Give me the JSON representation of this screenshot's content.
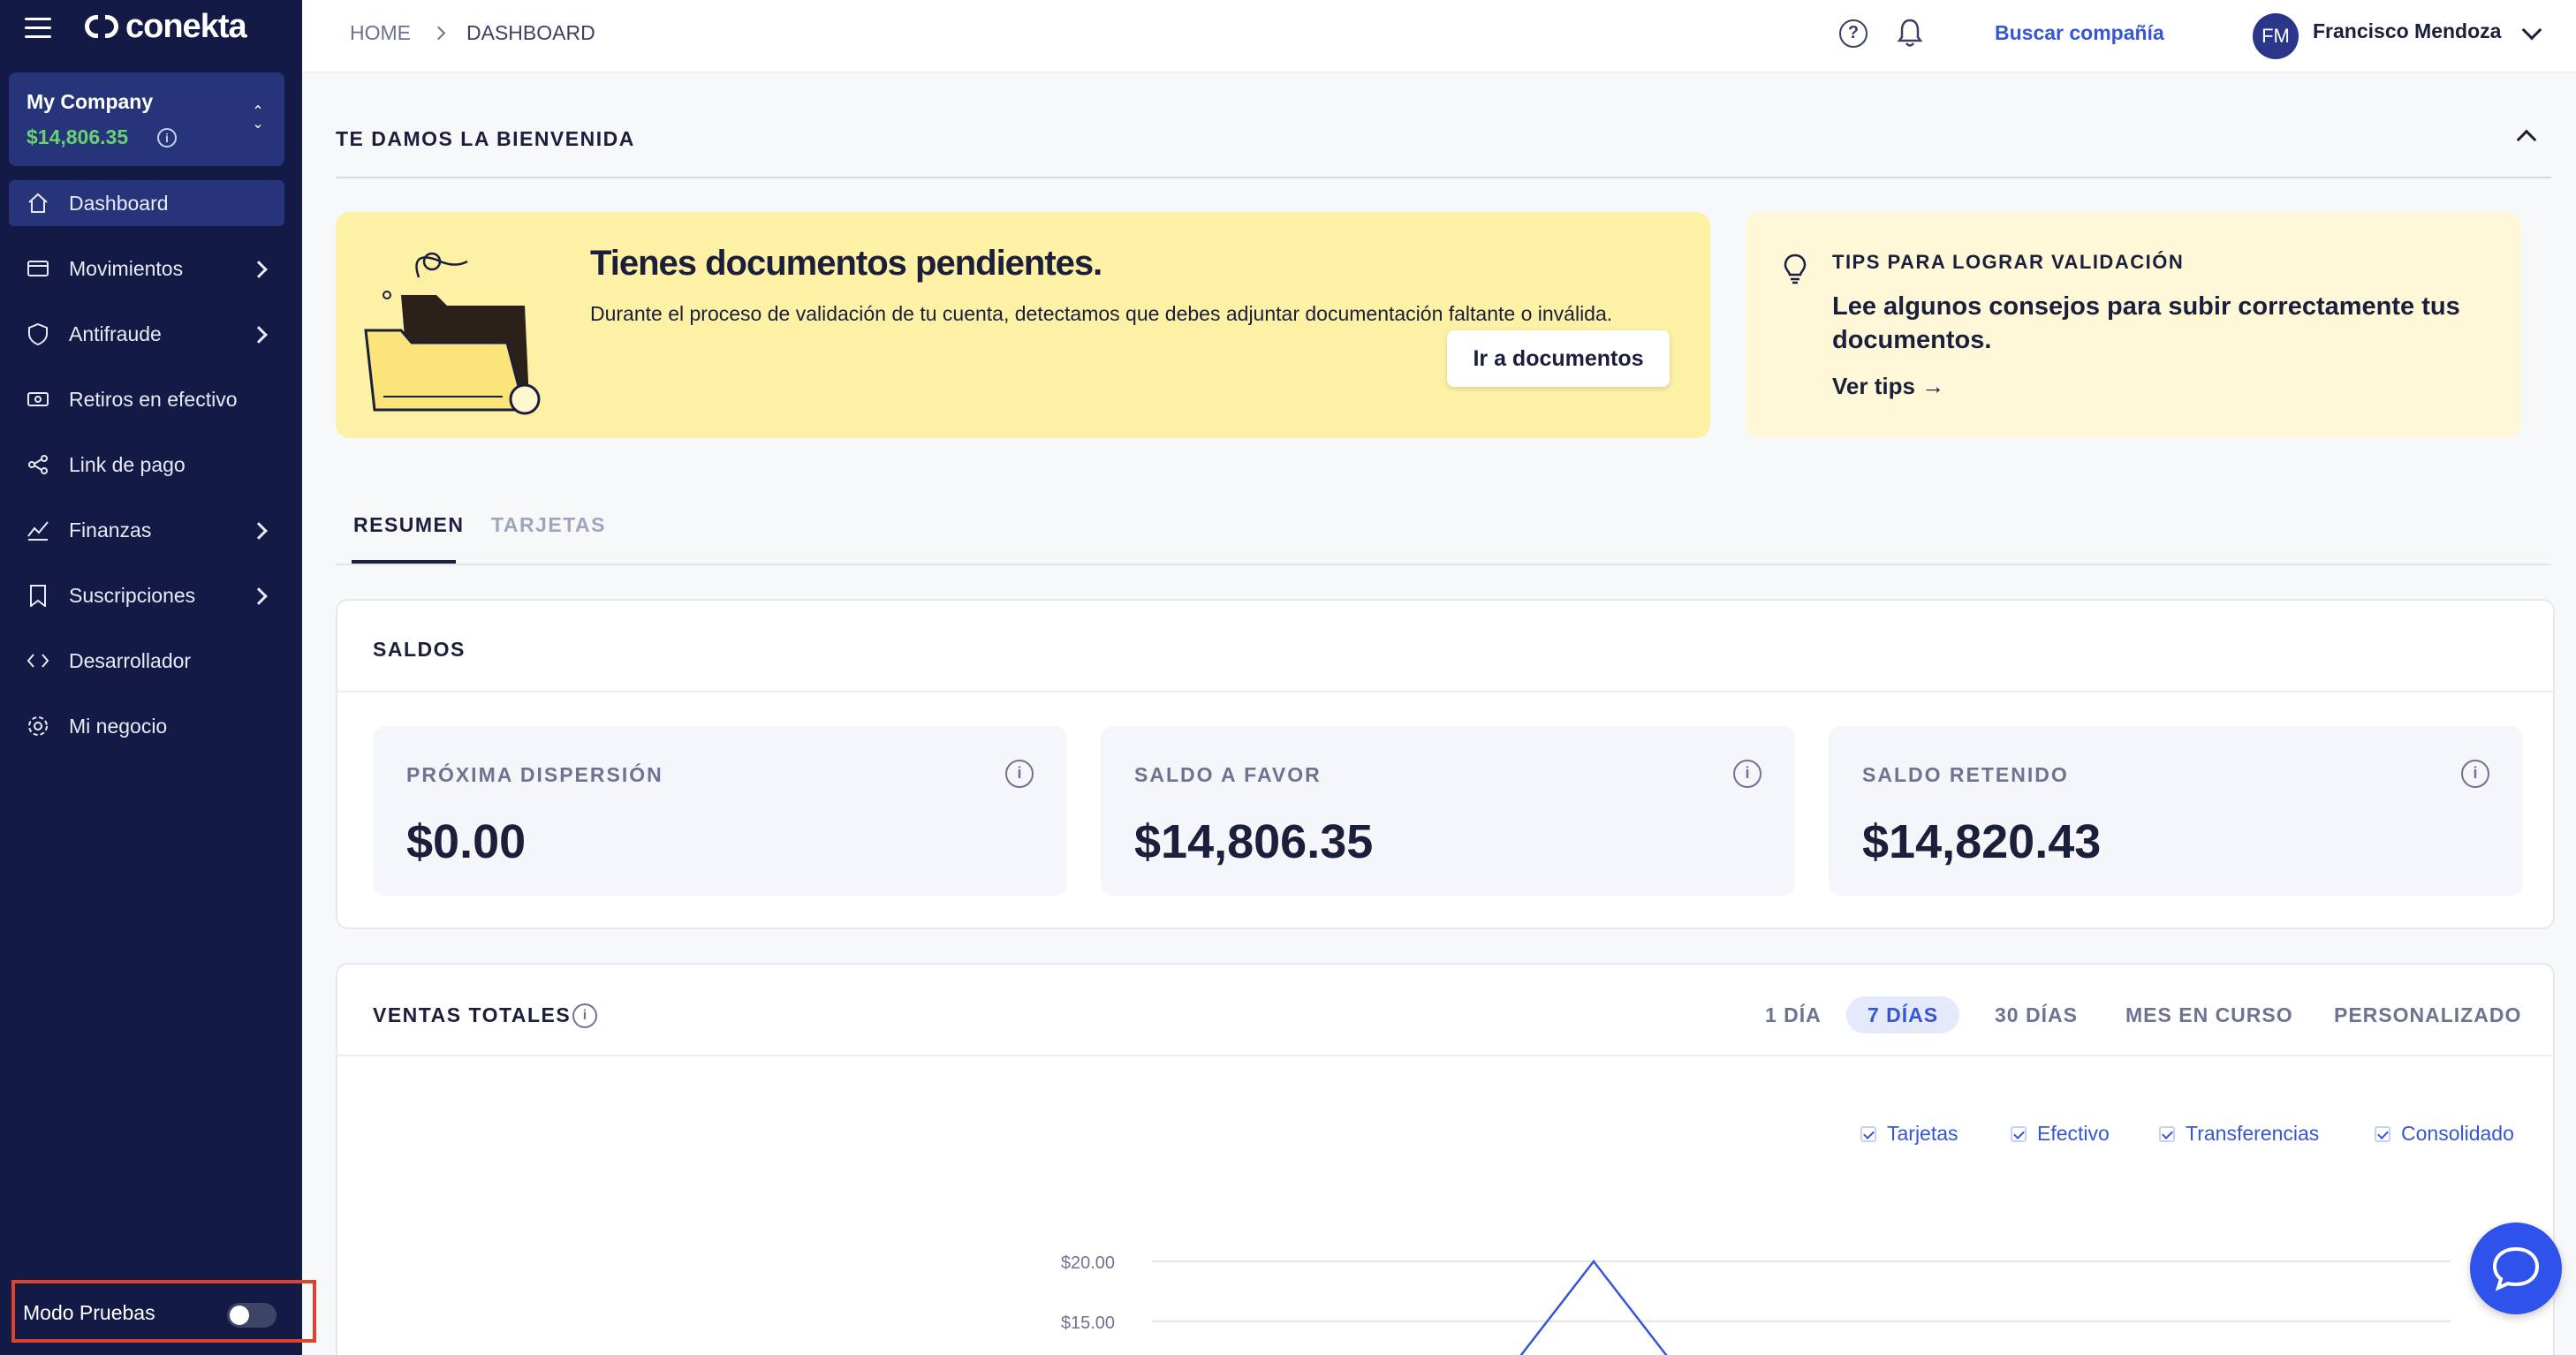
{
  "app": {
    "logo_text": "conekta"
  },
  "company": {
    "name": "My Company",
    "balance": "$14,806.35"
  },
  "nav": {
    "items": [
      {
        "label": "Dashboard",
        "icon": "home-icon",
        "active": true,
        "has_submenu": false
      },
      {
        "label": "Movimientos",
        "icon": "wallet-icon",
        "active": false,
        "has_submenu": true
      },
      {
        "label": "Antifraude",
        "icon": "shield-icon",
        "active": false,
        "has_submenu": true
      },
      {
        "label": "Retiros en efectivo",
        "icon": "cash-icon",
        "active": false,
        "has_submenu": false
      },
      {
        "label": "Link de pago",
        "icon": "share-icon",
        "active": false,
        "has_submenu": false
      },
      {
        "label": "Finanzas",
        "icon": "chart-line-icon",
        "active": false,
        "has_submenu": true
      },
      {
        "label": "Suscripciones",
        "icon": "bookmark-icon",
        "active": false,
        "has_submenu": true
      },
      {
        "label": "Desarrollador",
        "icon": "code-icon",
        "active": false,
        "has_submenu": false
      },
      {
        "label": "Mi negocio",
        "icon": "gear-icon",
        "active": false,
        "has_submenu": false
      }
    ]
  },
  "test_mode": {
    "label": "Modo Pruebas",
    "enabled": false
  },
  "header": {
    "breadcrumb": [
      "HOME",
      "DASHBOARD"
    ],
    "search_company": "Buscar compañía",
    "user_initials": "FM",
    "user_name": "Francisco Mendoza"
  },
  "welcome": {
    "title": "TE DAMOS LA BIENVENIDA",
    "pending": {
      "title": "Tienes documentos pendientes.",
      "description": "Durante el proceso de validación de tu cuenta, detectamos que debes adjuntar documentación faltante o inválida.",
      "button": "Ir a documentos"
    },
    "tips": {
      "label": "TIPS PARA LOGRAR VALIDACIÓN",
      "headline": "Lee algunos consejos para subir correctamente tus documentos.",
      "link": "Ver tips →"
    }
  },
  "tabs": [
    {
      "label": "RESUMEN",
      "active": true
    },
    {
      "label": "TARJETAS",
      "active": false
    }
  ],
  "balances": {
    "title": "SALDOS",
    "cards": [
      {
        "label": "PRÓXIMA DISPERSIÓN",
        "value": "$0.00"
      },
      {
        "label": "SALDO A FAVOR",
        "value": "$14,806.35"
      },
      {
        "label": "SALDO RETENIDO",
        "value": "$14,820.43"
      }
    ]
  },
  "sales": {
    "title": "VENTAS TOTALES",
    "ranges": [
      {
        "label": "1 DÍA",
        "active": false
      },
      {
        "label": "7 DÍAS",
        "active": true
      },
      {
        "label": "30 DÍAS",
        "active": false
      },
      {
        "label": "MES EN CURSO",
        "active": false
      },
      {
        "label": "PERSONALIZADO",
        "active": false
      }
    ],
    "legend": [
      "Tarjetas",
      "Efectivo",
      "Transferencias",
      "Consolidado"
    ]
  },
  "chart_data": {
    "type": "line",
    "y_ticks": [
      "$20.00",
      "$15.00"
    ],
    "series_color": "#3556d6",
    "grid": true
  },
  "colors": {
    "sidebar": "#121a45",
    "accent": "#3556d6",
    "positive": "#6ad173",
    "pending_card": "#fdf1a6"
  }
}
